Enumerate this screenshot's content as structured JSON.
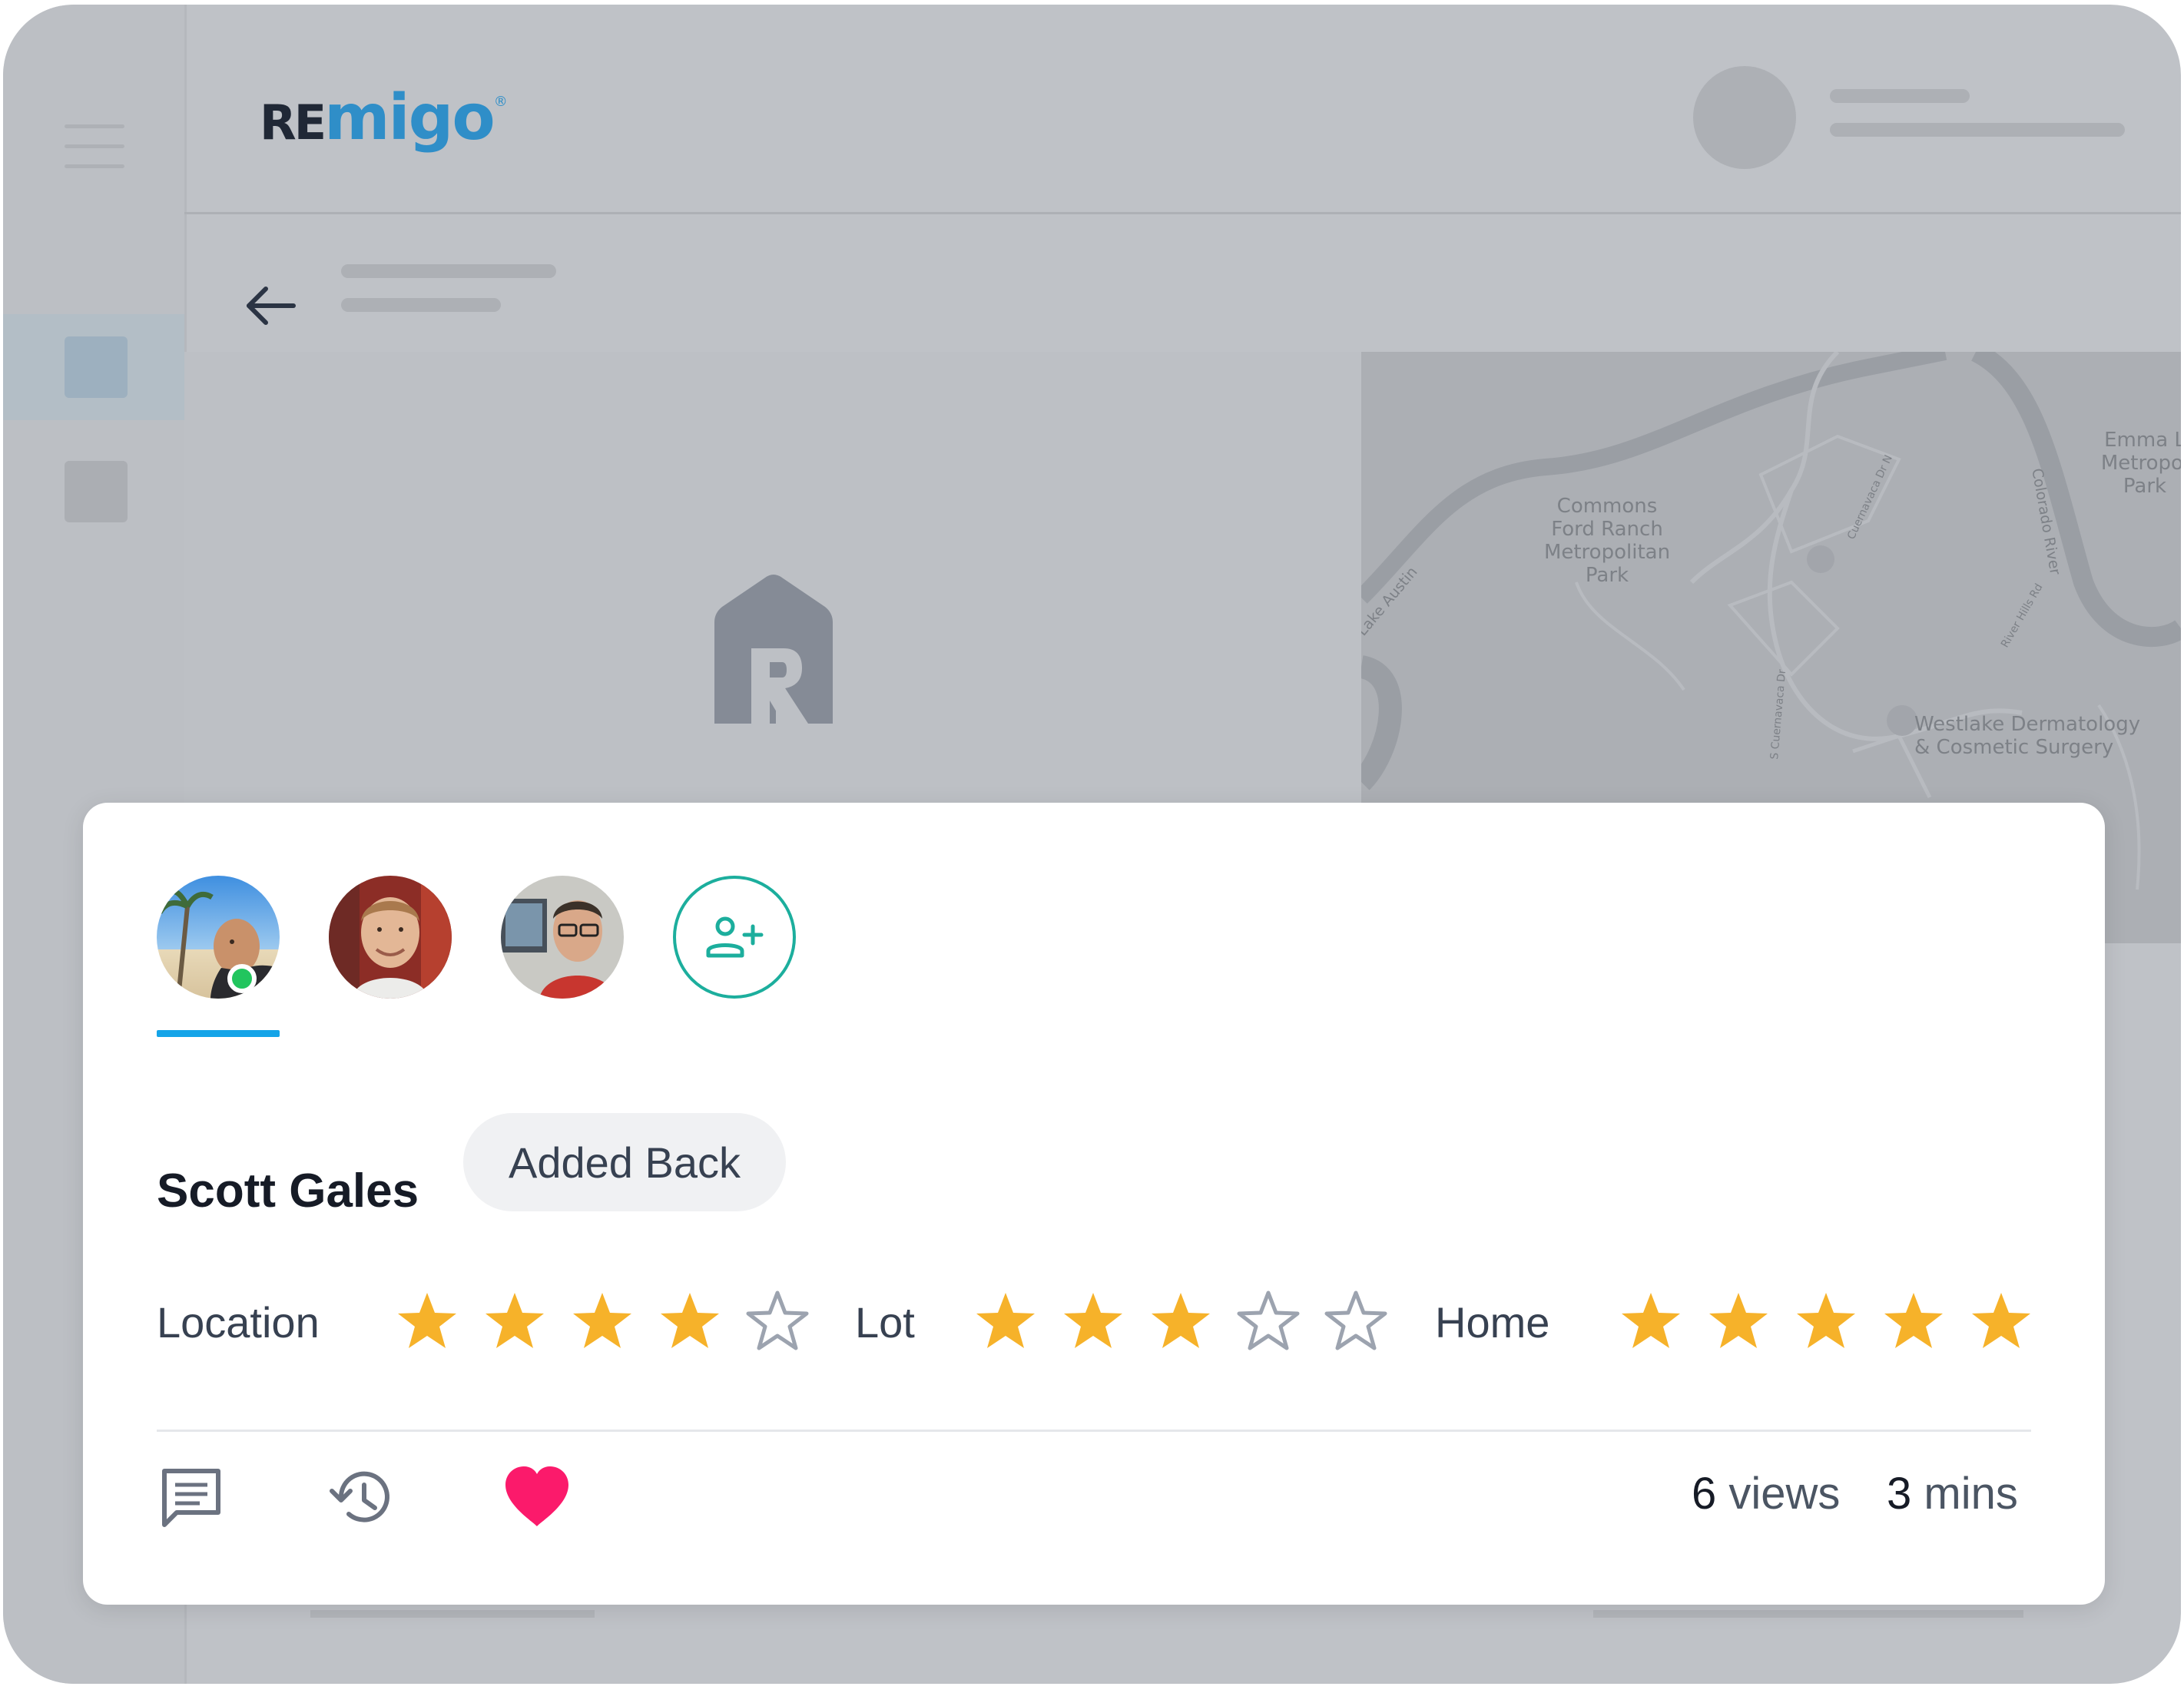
{
  "app": {
    "logo_re": "RE",
    "logo_migo": "migo",
    "logo_reg": "®"
  },
  "map": {
    "labels": {
      "park": "Commons\nFord Ranch\nMetropolitan\nPark",
      "emma": "Emma L\nMetropol\nPark",
      "river": "Colorado River",
      "lake": "Lake Austin",
      "clinic": "Westlake Dermatology\n& Cosmetic Surgery",
      "road1": "Cuernavaca Dr N",
      "road2": "S Cuernavaca Dr",
      "road3": "River Hills Rd"
    }
  },
  "card": {
    "members": [
      {
        "name": "Scott Gales",
        "online": true,
        "active": true
      },
      {
        "name": "member-2",
        "online": false,
        "active": false
      },
      {
        "name": "member-3",
        "online": false,
        "active": false
      }
    ],
    "selected_name": "Scott Gales",
    "status_badge": "Added Back",
    "ratings": [
      {
        "label": "Location",
        "value": 4,
        "max": 5
      },
      {
        "label": "Lot",
        "value": 3,
        "max": 5
      },
      {
        "label": "Home",
        "value": 5,
        "max": 5
      }
    ],
    "stats": {
      "views_count": "6",
      "views_unit": "views",
      "time_count": "3",
      "time_unit": "mins"
    },
    "favorited": true
  },
  "colors": {
    "star_filled": "#f6b22a",
    "star_empty": "#9ca3af",
    "heart": "#fb1a6b",
    "accent_teal": "#1cae9d",
    "accent_blue": "#14a4e8",
    "online": "#22c55e"
  },
  "icons": {
    "back": "arrow-left-icon",
    "add_member": "person-add-icon",
    "comment": "comment-icon",
    "history": "history-icon",
    "favorite": "heart-icon",
    "menu": "hamburger-icon",
    "brand": "remigo-house-r-icon"
  }
}
